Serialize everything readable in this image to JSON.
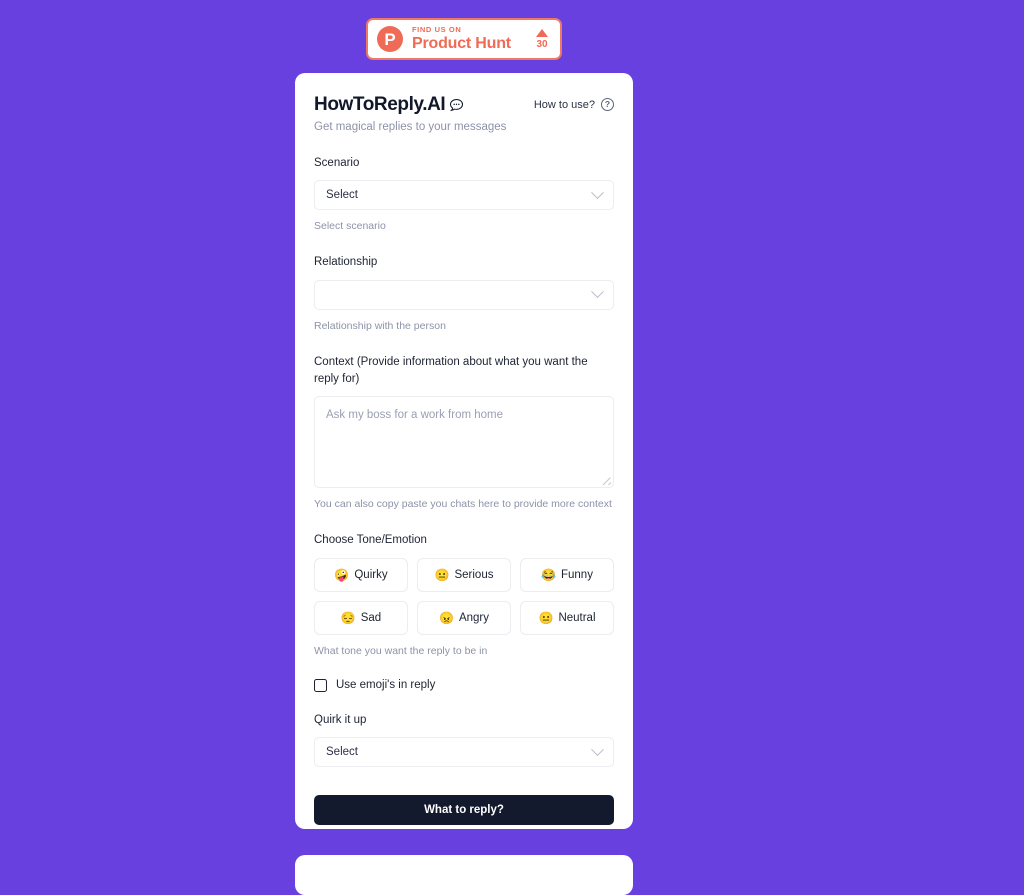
{
  "theme": {
    "page_background": "#6840e0",
    "card_background": "#ffffff",
    "accent_orange": "#ef6b55",
    "submit_background": "#131a2e",
    "helper_text_color": "#8d93a8"
  },
  "product_hunt_badge": {
    "logo_letter": "P",
    "find_us_on": "FIND US ON",
    "name": "Product Hunt",
    "upvote_count": "30"
  },
  "header": {
    "title": "HowToReply.AI",
    "title_icon": "speech-bubble-icon",
    "subtitle": "Get magical replies to your messages",
    "how_to_use_label": "How to use?",
    "how_to_use_icon": "question-circle-icon"
  },
  "scenario": {
    "label": "Scenario",
    "value": "Select",
    "helper": "Select scenario",
    "chevron_icon": "chevron-down-icon"
  },
  "relationship": {
    "label": "Relationship",
    "value": "",
    "helper": "Relationship with the person",
    "chevron_icon": "chevron-down-icon"
  },
  "context": {
    "label": "Context (Provide information about what you want the reply for)",
    "placeholder": "Ask my boss for a work from home",
    "value": "",
    "helper": "You can also copy paste you chats here to provide more context",
    "resize_handle_icon": "resize-grip-icon"
  },
  "tone": {
    "label": "Choose Tone/Emotion",
    "helper": "What tone you want the reply to be in",
    "options": [
      {
        "label": "Quirky",
        "emoji": "🤪"
      },
      {
        "label": "Serious",
        "emoji": "😐"
      },
      {
        "label": "Funny",
        "emoji": "😂"
      },
      {
        "label": "Sad",
        "emoji": "😔"
      },
      {
        "label": "Angry",
        "emoji": "😠"
      },
      {
        "label": "Neutral",
        "emoji": "😐"
      }
    ]
  },
  "emoji_checkbox": {
    "label": "Use emoji's in reply",
    "checked": false
  },
  "quirk": {
    "label": "Quirk it up",
    "value": "Select",
    "chevron_icon": "chevron-down-icon"
  },
  "submit": {
    "label": "What to reply?"
  }
}
